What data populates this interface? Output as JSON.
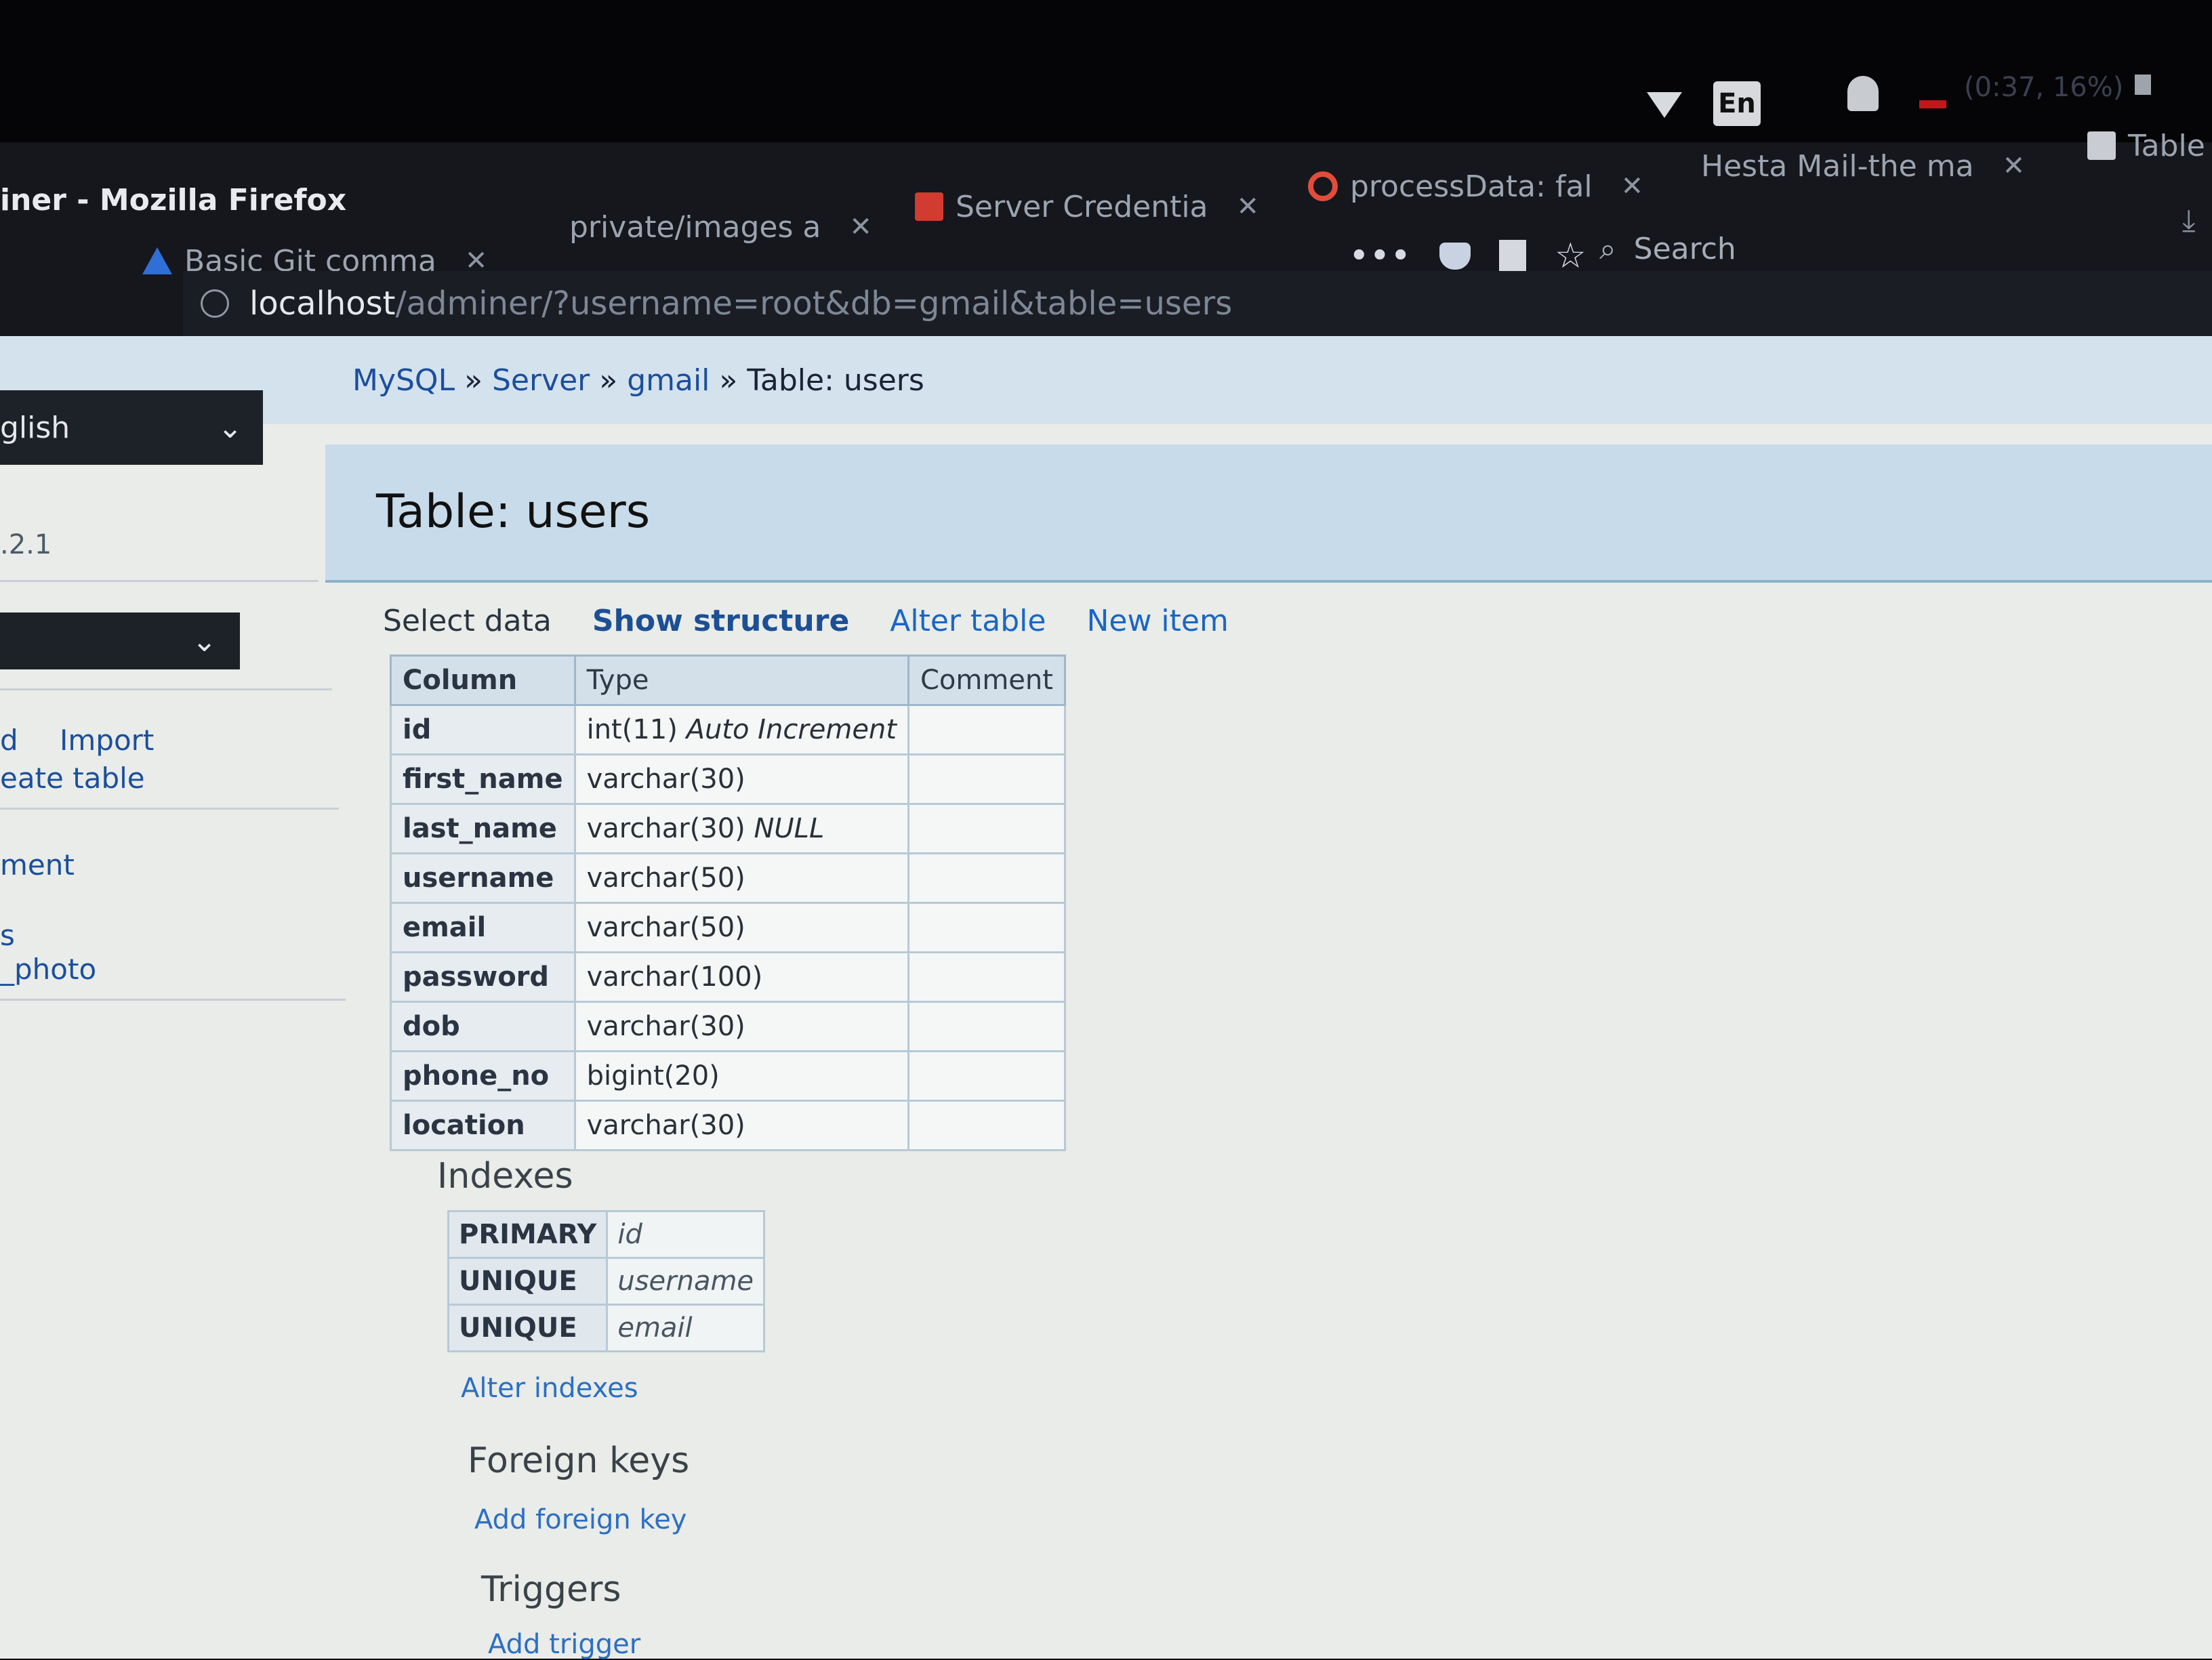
{
  "system_bar": {
    "language": "En",
    "battery": "(0:37, 16%)"
  },
  "window": {
    "title": "iner - Mozilla Firefox"
  },
  "tabs": [
    {
      "label": "Basic Git comma",
      "icon": "atlassian-icon"
    },
    {
      "label": "private/images a",
      "icon": ""
    },
    {
      "label": "Server Credentia",
      "icon": "gmail-icon"
    },
    {
      "label": "processData: fal",
      "icon": "google-icon"
    },
    {
      "label": "Hesta Mail-the ma",
      "icon": ""
    },
    {
      "label": "Table",
      "icon": "adminer-icon"
    }
  ],
  "toolbar": {
    "menu": "•••",
    "bookmark": "☆",
    "search_placeholder": "Search"
  },
  "url": {
    "host": "localhost",
    "path": "/adminer/?username=root&db=gmail&table=users"
  },
  "sidebar": {
    "language": "glish",
    "version": ".2.1",
    "links": [
      "d",
      "Import",
      "eate table",
      "ment",
      "s",
      "_photo"
    ]
  },
  "breadcrumb": {
    "items": [
      "MySQL",
      "Server",
      "gmail"
    ],
    "current": "Table: users",
    "sep": " » "
  },
  "page": {
    "title": "Table: users",
    "actions": [
      "Select data",
      "Show structure",
      "Alter table",
      "New item"
    ]
  },
  "structure": {
    "headers": [
      "Column",
      "Type",
      "Comment"
    ],
    "rows": [
      {
        "column": "id",
        "type": "int(11)",
        "extra": "Auto Increment"
      },
      {
        "column": "first_name",
        "type": "varchar(30)",
        "extra": ""
      },
      {
        "column": "last_name",
        "type": "varchar(30)",
        "extra": "NULL"
      },
      {
        "column": "username",
        "type": "varchar(50)",
        "extra": ""
      },
      {
        "column": "email",
        "type": "varchar(50)",
        "extra": ""
      },
      {
        "column": "password",
        "type": "varchar(100)",
        "extra": ""
      },
      {
        "column": "dob",
        "type": "varchar(30)",
        "extra": ""
      },
      {
        "column": "phone_no",
        "type": "bigint(20)",
        "extra": ""
      },
      {
        "column": "location",
        "type": "varchar(30)",
        "extra": ""
      }
    ]
  },
  "indexes": {
    "heading": "Indexes",
    "rows": [
      {
        "kind": "PRIMARY",
        "col": "id"
      },
      {
        "kind": "UNIQUE",
        "col": "username"
      },
      {
        "kind": "UNIQUE",
        "col": "email"
      }
    ],
    "alter_link": "Alter indexes"
  },
  "foreign_keys": {
    "heading": "Foreign keys",
    "add_link": "Add foreign key"
  },
  "triggers": {
    "heading": "Triggers",
    "add_link": "Add trigger"
  }
}
